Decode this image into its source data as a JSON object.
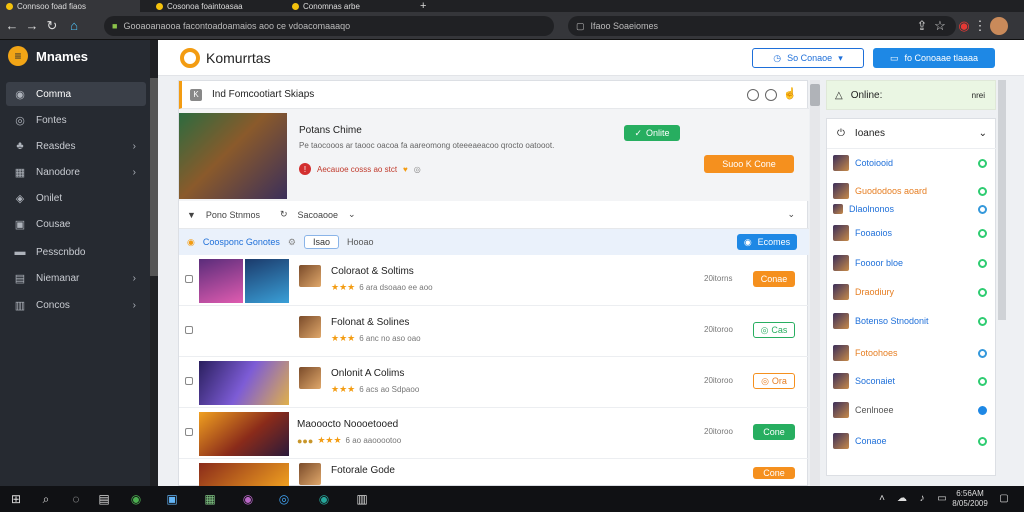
{
  "browser": {
    "tabs": [
      "Connsoo foad fiaos",
      "Cosonoa foaintoasaa",
      "Conomnas arbe"
    ],
    "url": "Gooaoanaooa facontoadoamaios aoo ce vdoacomaaaqo",
    "search_text": "Ifaoo Soaeiomes"
  },
  "sidebar": {
    "app_name": "Mnames",
    "items": [
      {
        "label": "Comma",
        "icon": "gamepad-icon"
      },
      {
        "label": "Fontes",
        "icon": "compass-icon"
      },
      {
        "label": "Reasdes",
        "icon": "users-icon"
      },
      {
        "label": "Nanodore",
        "icon": "grid-icon"
      },
      {
        "label": "Onilet",
        "icon": "shield-icon"
      },
      {
        "label": "Cousae",
        "icon": "chat-icon"
      },
      {
        "label": "Pesscnbdo",
        "icon": "folder-icon"
      },
      {
        "label": "Niemanar",
        "icon": "list-icon"
      },
      {
        "label": "Concos",
        "icon": "stack-icon"
      }
    ]
  },
  "header": {
    "title": "Komurrtas",
    "btn_outline": "So Conaoe",
    "btn_blue": "fo Conoaae tlaaaa"
  },
  "search_bar": {
    "text": "Ind Fomcootiart Skiaps"
  },
  "featured": {
    "title": "Potans Chime",
    "subtitle": "Pe taocooos ar taooc oacoa fa aareomong oteeeaeacoo qrocto oatooot.",
    "meta": "Aecauoe cosss ao stct",
    "btn_online": "Onlite",
    "btn_orange": "Suoo K Cone"
  },
  "toolbar": {
    "filter1": "Pono Stnmos",
    "filter2": "Sacoaooe"
  },
  "filter_row": {
    "label": "Coosponc Gonotes",
    "chip": "Isao",
    "chip2": "Hooao",
    "btn": "Ecomes"
  },
  "rows": [
    {
      "name": "Coloraot & Soltims",
      "meta": "6 ara dsoaao ee aoo",
      "time": "20itorns",
      "action": "Conae"
    },
    {
      "name": "Folonat & Solines",
      "meta": "6 anc no aso oao",
      "time": "20itoroo",
      "action": "Cas"
    },
    {
      "name": "Onlonit A Colims",
      "meta": "6 acs ao Sdpaoo",
      "time": "20itoroo",
      "action": "Ora"
    },
    {
      "name": "Maooocto Noooetooed",
      "meta": "6 ao aaooootoo",
      "time": "20itoroo",
      "action": "Cone"
    },
    {
      "name": "Fotorale Gode",
      "meta": "",
      "time": "",
      "action": "Cone"
    }
  ],
  "right": {
    "online_label": "Online:",
    "online_count": "nrei",
    "list_title": "Ioanes",
    "users": [
      "Cotoiooid",
      "Guododoos aoard",
      "Dlaolnonos",
      "Fooaoios",
      "Foooor bloe",
      "Draodiury",
      "Botenso Stnodonit",
      "Fotoohoes",
      "Soconaiet",
      "Cenlnoee",
      "Conaoe"
    ]
  },
  "taskbar": {
    "time": "6:56AM",
    "date": "8/05/2009"
  }
}
